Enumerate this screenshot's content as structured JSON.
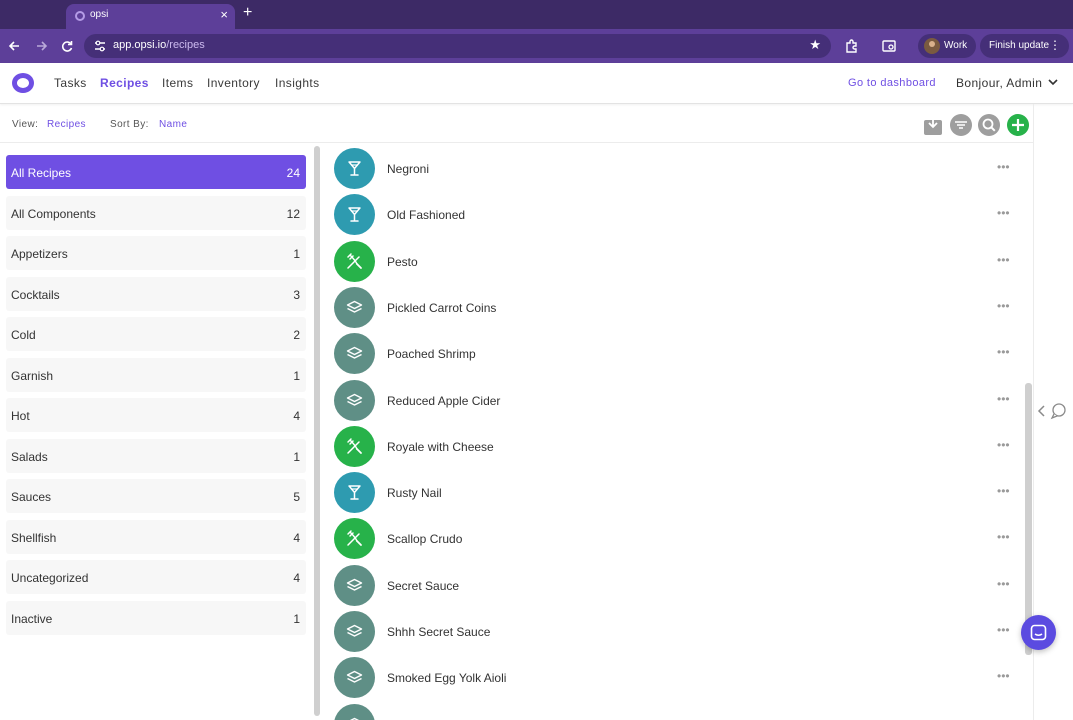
{
  "browser": {
    "tab_title": "opsi",
    "url_host": "app.opsi.io",
    "url_path": "/recipes",
    "profile_label": "Work",
    "update_label": "Finish update"
  },
  "header": {
    "nav": [
      "Tasks",
      "Recipes",
      "Items",
      "Inventory",
      "Insights"
    ],
    "active_nav": "Recipes",
    "dashboard_link": "Go to dashboard",
    "greeting": "Bonjour, Admin"
  },
  "viewbar": {
    "view_label": "View:",
    "view_value": "Recipes",
    "sort_label": "Sort By:",
    "sort_value": "Name"
  },
  "sidebar": {
    "categories": [
      {
        "label": "All Recipes",
        "count": "24",
        "active": true
      },
      {
        "label": "All Components",
        "count": "12"
      },
      {
        "label": "Appetizers",
        "count": "1"
      },
      {
        "label": "Cocktails",
        "count": "3"
      },
      {
        "label": "Cold",
        "count": "2"
      },
      {
        "label": "Garnish",
        "count": "1"
      },
      {
        "label": "Hot",
        "count": "4"
      },
      {
        "label": "Salads",
        "count": "1"
      },
      {
        "label": "Sauces",
        "count": "5"
      },
      {
        "label": "Shellfish",
        "count": "4"
      },
      {
        "label": "Uncategorized",
        "count": "4"
      },
      {
        "label": "Inactive",
        "count": "1"
      }
    ]
  },
  "recipes": [
    {
      "name": "Negroni",
      "icon": "cocktail-glass-icon",
      "color": "#2e9bb0"
    },
    {
      "name": "Old Fashioned",
      "icon": "cocktail-glass-icon",
      "color": "#2e9bb0"
    },
    {
      "name": "Pesto",
      "icon": "fork-knife-icon",
      "color": "#27b24a"
    },
    {
      "name": "Pickled Carrot Coins",
      "icon": "layers-icon",
      "color": "#5f8f86"
    },
    {
      "name": "Poached Shrimp",
      "icon": "layers-icon",
      "color": "#5f8f86"
    },
    {
      "name": "Reduced Apple Cider",
      "icon": "layers-icon",
      "color": "#5f8f86"
    },
    {
      "name": "Royale with Cheese",
      "icon": "fork-knife-icon",
      "color": "#27b24a"
    },
    {
      "name": "Rusty Nail",
      "icon": "cocktail-glass-icon",
      "color": "#2e9bb0"
    },
    {
      "name": "Scallop Crudo",
      "icon": "fork-knife-icon",
      "color": "#27b24a"
    },
    {
      "name": "Secret Sauce",
      "icon": "layers-icon",
      "color": "#5f8f86"
    },
    {
      "name": "Shhh Secret Sauce",
      "icon": "layers-icon",
      "color": "#5f8f86"
    },
    {
      "name": "Smoked Egg Yolk Aioli",
      "icon": "layers-icon",
      "color": "#5f8f86"
    },
    {
      "name": "",
      "icon": "layers-icon",
      "color": "#5f8f86"
    }
  ],
  "colors": {
    "accent": "#6f4fe3",
    "browser_frame": "#5d3f99",
    "add_button": "#27b24a",
    "tool_button": "#9e9e9e"
  }
}
